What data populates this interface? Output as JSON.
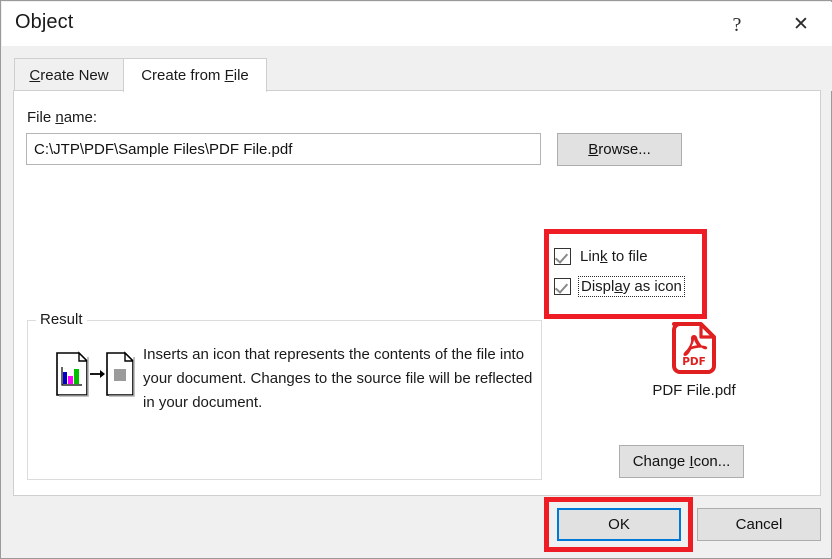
{
  "dialog": {
    "title": "Object",
    "help_glyph": "?",
    "close_glyph": "✕",
    "help_icon_name": "help-icon",
    "close_icon_name": "close-icon"
  },
  "tabs": [
    {
      "label": "Create New",
      "accel": "C",
      "active": false
    },
    {
      "label": "Create from File",
      "accel": "F",
      "active": true
    }
  ],
  "file_section": {
    "label": "File name:",
    "label_accel": "n",
    "value": "C:\\JTP\\PDF\\Sample Files\\PDF File.pdf",
    "placeholder": "",
    "browse_label": "Browse...",
    "browse_accel": "B"
  },
  "options": [
    {
      "label": "Link to file",
      "accel": "k",
      "checked": true,
      "focused": false
    },
    {
      "label": "Display as icon",
      "accel": "a",
      "checked": true,
      "focused": true
    }
  ],
  "result": {
    "legend": "Result",
    "description": "Inserts an icon that represents the contents of the file into your document.  Changes to the source file will be reflected in your document.",
    "icon_name": "document-to-icon-illustration"
  },
  "preview": {
    "icon_name": "pdf-file-icon",
    "icon_text": "PDF",
    "filename": "PDF File.pdf",
    "change_icon_label": "Change Icon...",
    "change_icon_accel": "I"
  },
  "footer": {
    "ok_label": "OK",
    "cancel_label": "Cancel"
  },
  "annotations": [
    {
      "name": "checkbox-highlight",
      "color": "#ee1c25"
    },
    {
      "name": "ok-button-highlight",
      "color": "#ee1c25"
    }
  ],
  "colors": {
    "accent": "#0078d7",
    "annotation": "#ee1c25",
    "dialog_bg": "#f0f0f0",
    "content_bg": "#ffffff",
    "button_bg": "#e1e1e1",
    "pdf_red": "#e02020"
  }
}
